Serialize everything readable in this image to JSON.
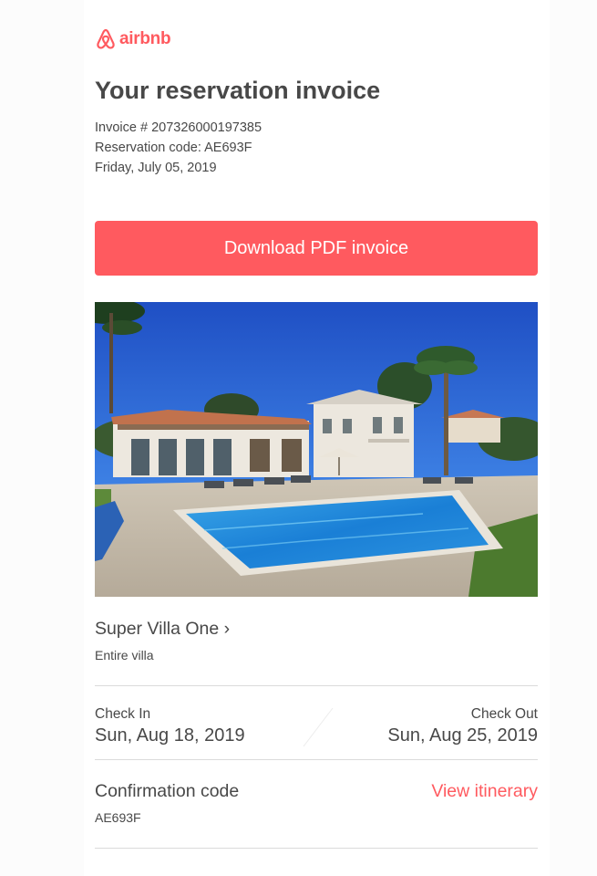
{
  "brand": {
    "logo_text": "airbnb",
    "logo_icon": "airbnb-belo-icon",
    "accent_color": "#ff5a5f"
  },
  "invoice": {
    "title": "Your reservation invoice",
    "invoice_number": "Invoice # 207326000197385",
    "reservation_code": "Reservation code: AE693F",
    "date": "Friday, July 05, 2019",
    "download_label": "Download PDF invoice"
  },
  "listing": {
    "photo_icon": "villa-photo",
    "name": "Super Villa One ›",
    "type": "Entire villa"
  },
  "stay": {
    "check_in_label": "Check In",
    "check_in_date": "Sun, Aug 18, 2019",
    "check_out_label": "Check Out",
    "check_out_date": "Sun, Aug 25, 2019"
  },
  "confirmation": {
    "label": "Confirmation code",
    "code": "AE693F",
    "itinerary_link": "View itinerary"
  }
}
